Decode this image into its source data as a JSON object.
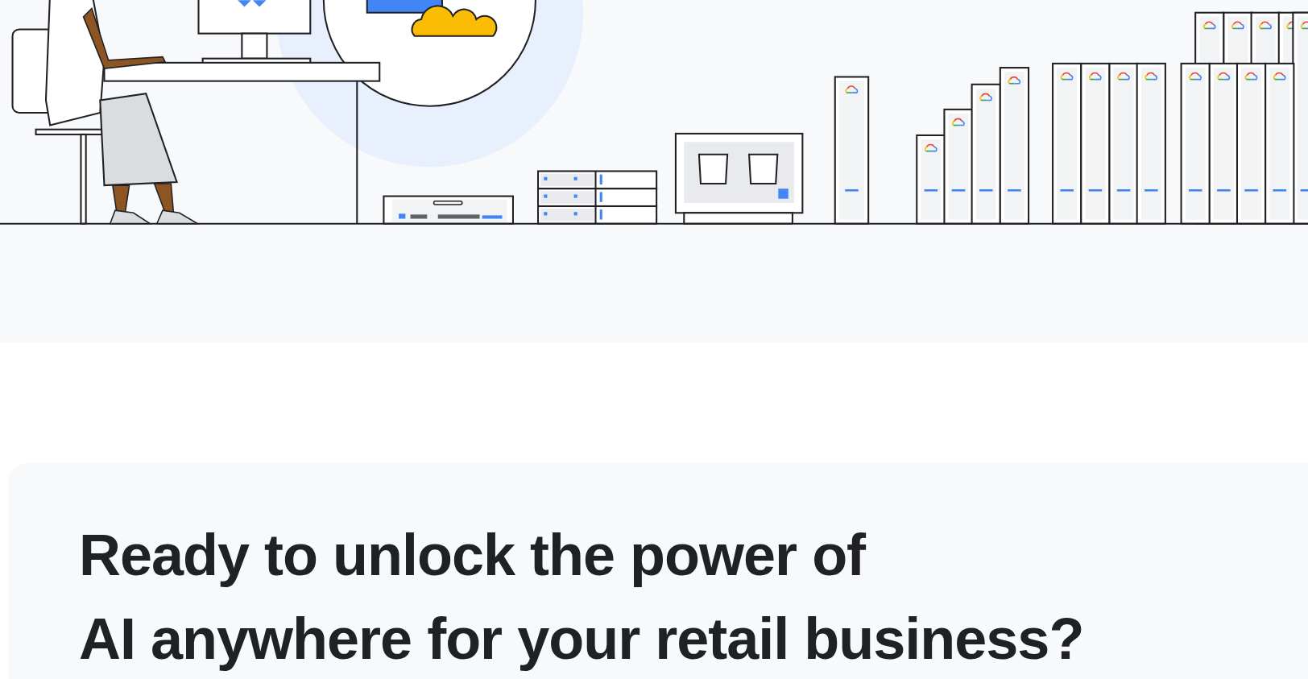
{
  "cta": {
    "heading_lines": [
      "Ready to unlock the power of",
      "AI anywhere for your retail business?"
    ]
  }
}
